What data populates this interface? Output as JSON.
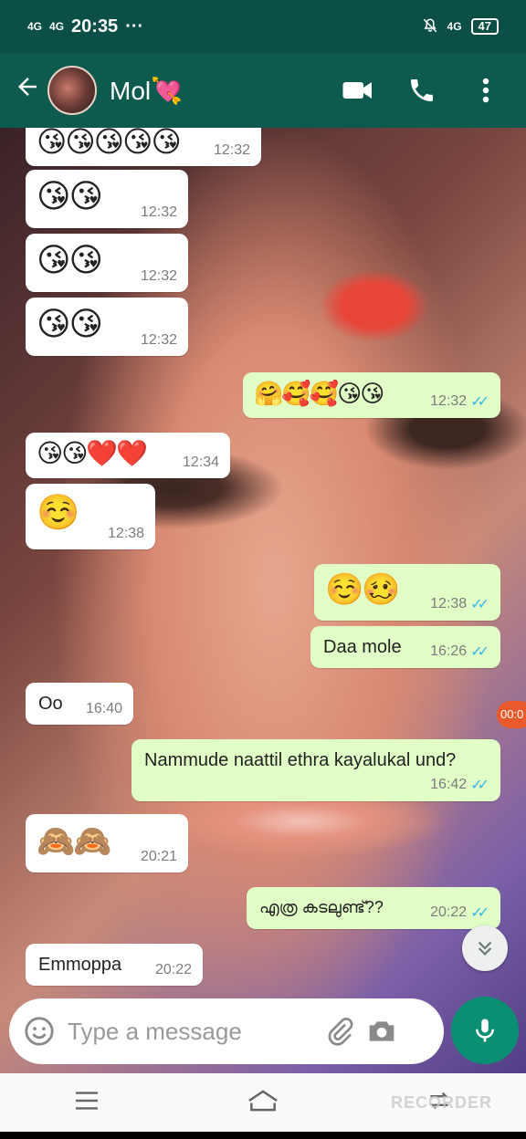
{
  "status_bar": {
    "network_left": "4G",
    "network_left2": "4G",
    "time": "20:35",
    "more": "···",
    "network_right": "4G",
    "battery": "47"
  },
  "app_bar": {
    "contact_name": "Mol💘",
    "icons": [
      "back-arrow-icon",
      "video-call-icon",
      "voice-call-icon",
      "more-options-icon"
    ]
  },
  "messages": [
    {
      "direction": "in",
      "type": "emoji",
      "content": "😘😘😘😘😘",
      "time": "12:32"
    },
    {
      "direction": "in",
      "type": "emoji",
      "content": "😘😘",
      "time": "12:32"
    },
    {
      "direction": "in",
      "type": "emoji",
      "content": "😘😘",
      "time": "12:32"
    },
    {
      "direction": "in",
      "type": "emoji",
      "content": "😘😘",
      "time": "12:32"
    },
    {
      "direction": "out",
      "type": "emoji",
      "content": "🤗🥰🥰😘😘",
      "time": "12:32",
      "read": "✓✓"
    },
    {
      "direction": "in",
      "type": "emoji",
      "content": "😘😘❤️❤️",
      "time": "12:34"
    },
    {
      "direction": "in",
      "type": "emoji",
      "content": "☺️",
      "time": "12:38"
    },
    {
      "direction": "out",
      "type": "emoji",
      "content": "☺️🥴",
      "time": "12:38",
      "read": "✓✓"
    },
    {
      "direction": "out",
      "type": "text",
      "content": "Daa mole",
      "time": "16:26",
      "read": "✓✓"
    },
    {
      "direction": "in",
      "type": "text",
      "content": "Oo",
      "time": "16:40"
    },
    {
      "direction": "out",
      "type": "text",
      "content": "Nammude naattil ethra kayalukal und?",
      "time": "16:42",
      "read": "✓✓"
    },
    {
      "direction": "in",
      "type": "emoji",
      "content": "🙈🙈",
      "time": "20:21"
    },
    {
      "direction": "out",
      "type": "text",
      "content": "എത്ര കടലുണ്ട്??",
      "time": "20:22",
      "read": "✓✓"
    },
    {
      "direction": "in",
      "type": "text",
      "content": "Emmoppa",
      "time": "20:22"
    }
  ],
  "side_timer": "00:0",
  "scroll_down_icon": "double-chevron-down-icon",
  "composer": {
    "placeholder": "Type a message",
    "icons": [
      "emoji-icon",
      "attach-icon",
      "camera-icon",
      "mic-icon"
    ]
  },
  "watermark": "RECORDER",
  "colors": {
    "header": "#0c5b4e",
    "outgoing_bubble": "#e1fec6",
    "incoming_bubble": "#ffffff",
    "read_tick": "#34b7f1",
    "mic_button": "#0a8f73"
  }
}
